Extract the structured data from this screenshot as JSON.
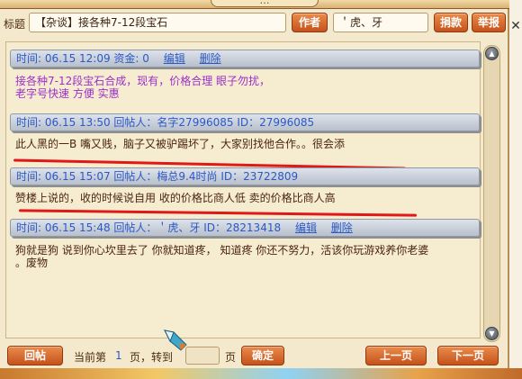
{
  "window": {
    "title": "…"
  },
  "header": {
    "subject_label": "标题",
    "subject_value": "【杂谈】接各种7-12段宝石",
    "author_button": "作者",
    "author_value": "＇虎、牙",
    "donate_button": "捐款",
    "report_button": "举报"
  },
  "posts": [
    {
      "meta": "时间: 06.15 12:09   资金: 0",
      "edit": "编辑",
      "delete": "删除",
      "lines": [
        "接各种7-12段宝石合成，现有，价格合理 眼子勿扰，",
        "老字号快速 方便 实惠"
      ]
    },
    {
      "meta": "时间: 06.15 13:50   回帖人：名字27996085   ID：27996085",
      "lines": [
        "此人黑的一B 嘴又贱，脑子又被驴踢坏了，大家别找他合作。。很会添"
      ]
    },
    {
      "meta": "时间: 06.15 15:07   回帖人：梅总9.4时尚   ID：23722809",
      "lines": [
        "赞楼上说的，收的时候说自用 收的价格比商人低 卖的价格比商人高"
      ]
    },
    {
      "meta": "时间: 06.15 15:48   回帖人：＇虎、牙   ID：28213418",
      "edit": "编辑",
      "delete": "删除",
      "lines": [
        "狗就是狗 说到你心坎里去了 你就知道疼， 知道疼 你还不努力，活该你玩游戏养你老婆",
        "。废物"
      ]
    }
  ],
  "footer": {
    "reply_button": "回帖",
    "current_page_prefix": "当前第",
    "current_page": "1",
    "page_suffix_goto": "页，转到",
    "page_suffix": "页",
    "confirm_button": "确定",
    "prev_button": "上一页",
    "next_button": "下一页"
  },
  "colors": {
    "meta_text": "#2b59c8",
    "purple_text": "#9b2fc9",
    "red_mark": "#e01818",
    "button_orange": "#c6521b"
  },
  "icons": {
    "close": "close-icon",
    "scroll_up": "scroll-up-icon",
    "scroll_down": "scroll-down-icon",
    "cursor": "gem-cursor-icon"
  }
}
